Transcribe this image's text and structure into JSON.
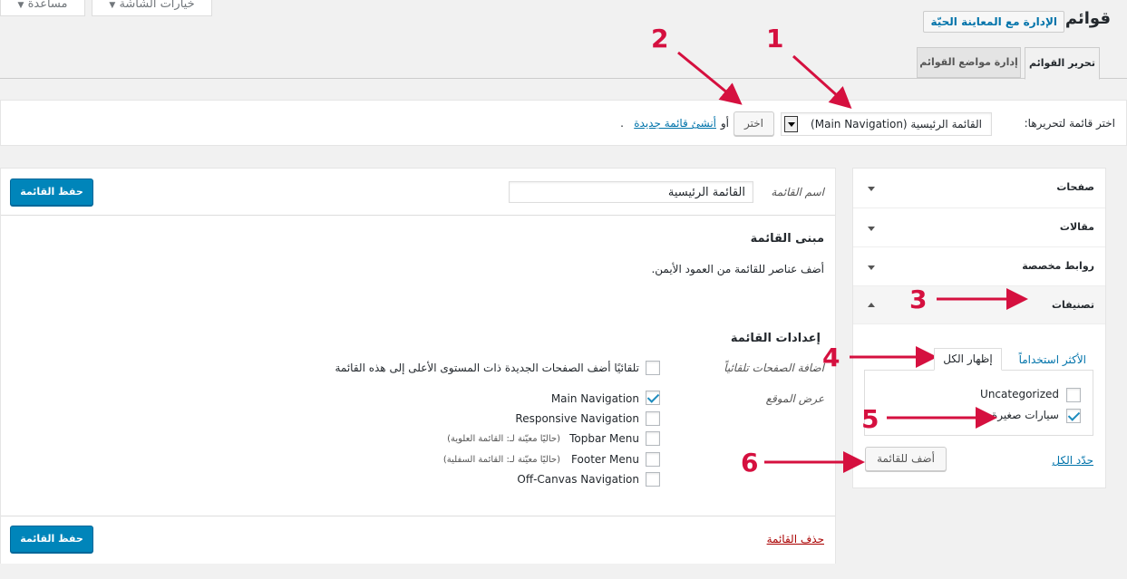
{
  "top": {
    "screen_options": "خيارات الشاشة",
    "help": "مساعدة",
    "page_title": "قوائم",
    "live_preview": "الإدارة مع المعاينة الحيّة"
  },
  "tabs": {
    "edit_menus": "تحرير القوائم",
    "manage_locations": "إدارة مواضع القوائم"
  },
  "select_bar": {
    "label": "اختر قائمة لتحريرها:",
    "selected": "القائمة الرئيسية (Main Navigation)",
    "select_button": "اختر",
    "or": "أو",
    "create_link": "أنشئ قائمة جديدة",
    "period": "."
  },
  "accordion": {
    "pages": "صفحات",
    "posts": "مقالات",
    "custom_links": "روابط مخصصة",
    "categories": "تصنيفات",
    "tab_most_used": "الأكثر استخداماً",
    "tab_view_all": "إظهار الكل",
    "items": [
      {
        "label": "Uncategorized",
        "checked": false
      },
      {
        "label": "سيارات صغيرة",
        "checked": true
      }
    ],
    "select_all": "حدّد الكل",
    "add_to_menu": "أضف للقائمة"
  },
  "menu_editor": {
    "name_label": "اسم القائمة",
    "name_value": "القائمة الرئيسية",
    "save_top": "حفظ القائمة",
    "structure_title": "مبنى القائمة",
    "structure_hint": "أضف عناصر للقائمة من العمود الأيمن.",
    "settings_title": "إعدادات القائمة",
    "auto_add_label": "اضافة الصفحات تلقائياً",
    "auto_add_text": "تلقائيًا أضف الصفحات الجديدة ذات المستوى الأعلى إلى هذه القائمة",
    "display_location_label": "عرض الموقع",
    "locations": [
      {
        "name": "Main Navigation",
        "note": "",
        "checked": true
      },
      {
        "name": "Responsive Navigation",
        "note": "",
        "checked": false
      },
      {
        "name": "Topbar Menu",
        "note": "(حاليًا معيّنة لـ: القائمة العلوية)",
        "checked": false
      },
      {
        "name": "Footer Menu",
        "note": "(حاليًا معيّنة لـ: القائمة السفلية)",
        "checked": false
      },
      {
        "name": "Off-Canvas Navigation",
        "note": "",
        "checked": false
      }
    ],
    "delete_menu": "حذف القائمة",
    "save_bottom": "حفظ القائمة"
  },
  "annotations": [
    "1",
    "2",
    "3",
    "4",
    "5",
    "6"
  ],
  "colors": {
    "accent": "#0085ba",
    "annotation": "#d5103f",
    "link": "#0073aa",
    "delete": "#aa0000"
  }
}
